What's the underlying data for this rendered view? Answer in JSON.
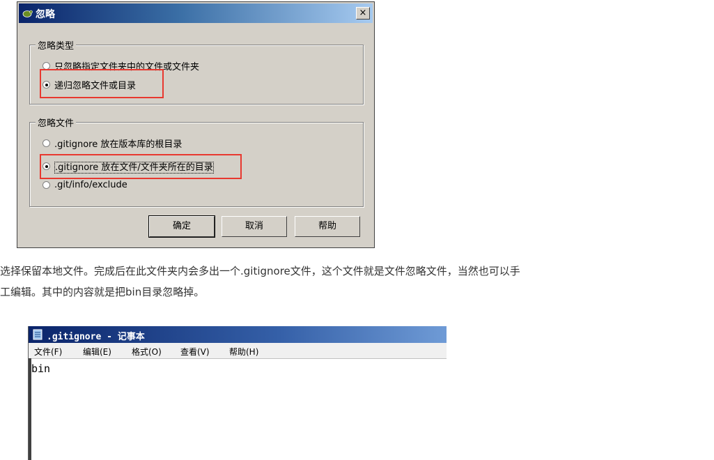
{
  "dialog": {
    "title": "忽略",
    "close_label": "×",
    "group_type": {
      "legend": "忽略类型",
      "options": [
        "只忽略指定文件夹中的文件或文件夹",
        "递归忽略文件或目录"
      ],
      "selected_index": 1
    },
    "group_file": {
      "legend": "忽略文件",
      "options": [
        ".gitignore 放在版本库的根目录",
        ".gitignore 放在文件/文件夹所在的目录",
        ".git/info/exclude"
      ],
      "selected_index": 1
    },
    "buttons": {
      "ok": "确定",
      "cancel": "取消",
      "help": "帮助"
    }
  },
  "paragraph": {
    "line1": "选择保留本地文件。完成后在此文件夹内会多出一个.gitignore文件，这个文件就是文件忽略文件，当然也可以手",
    "line2": "工编辑。其中的内容就是把bin目录忽略掉。"
  },
  "notepad": {
    "title": ".gitignore - 记事本",
    "menu": [
      "文件(F)",
      "编辑(E)",
      "格式(O)",
      "查看(V)",
      "帮助(H)"
    ],
    "content": "bin"
  },
  "colors": {
    "highlight_box": "#e8382f",
    "dialog_bg": "#d4d0c8",
    "titlebar": "#0a246a"
  }
}
